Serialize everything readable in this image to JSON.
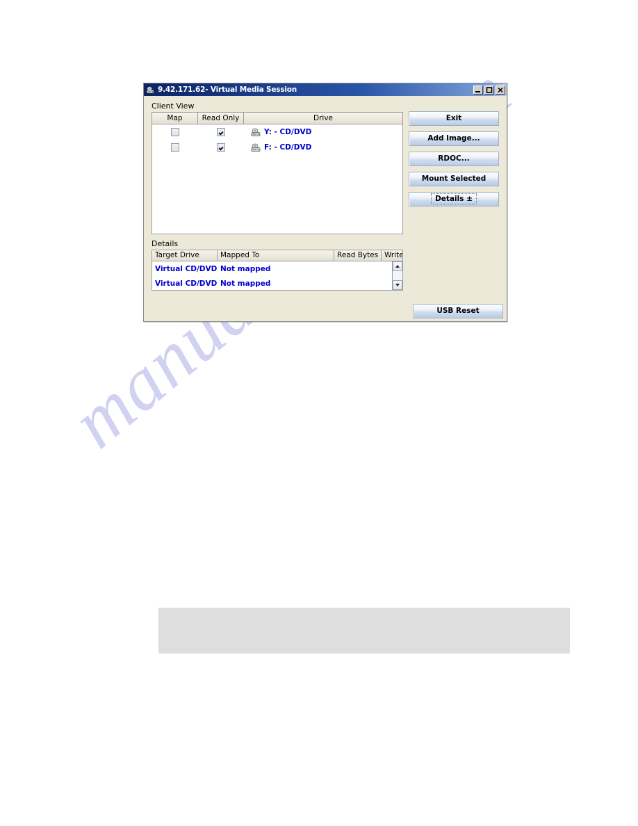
{
  "window": {
    "title": "9.42.171.62- Virtual Media Session",
    "title_icon": "virtual-media-icon",
    "minimize_label": "_",
    "maximize_label": "□",
    "close_label": "×"
  },
  "client_view": {
    "label": "Client View",
    "columns": [
      "Map",
      "Read Only",
      "Drive"
    ],
    "rows": [
      {
        "map_checked": false,
        "read_only_checked": true,
        "drive": "Y: - CD/DVD",
        "icon": "cd-drive-icon"
      },
      {
        "map_checked": false,
        "read_only_checked": true,
        "drive": "F: - CD/DVD",
        "icon": "cd-drive-icon"
      }
    ]
  },
  "buttons": {
    "exit": "Exit",
    "add_image": "Add Image...",
    "rdoc": "RDOC...",
    "mount_selected": "Mount Selected",
    "details": "Details",
    "details_glyph": "±",
    "usb_reset": "USB Reset"
  },
  "details": {
    "label": "Details",
    "columns": [
      "Target Drive",
      "Mapped To",
      "Read Bytes",
      "Write Byt"
    ],
    "rows": [
      {
        "target_drive": "Virtual CD/DVD",
        "mapped_to": "Not mapped",
        "read_bytes": "",
        "write_bytes": ""
      },
      {
        "target_drive": "Virtual CD/DVD",
        "mapped_to": "Not mapped",
        "read_bytes": "",
        "write_bytes": ""
      }
    ],
    "scrollbar": {
      "up": "scroll-up-arrow",
      "down": "scroll-down-arrow"
    }
  },
  "page": {
    "watermark": "manualshive.com"
  },
  "colors": {
    "title_bar": "#16357e",
    "link_text": "#0000cc",
    "dialog_face": "#ece9d8",
    "button_face": "#cfdcef",
    "watermark": "#c9c9ef"
  }
}
